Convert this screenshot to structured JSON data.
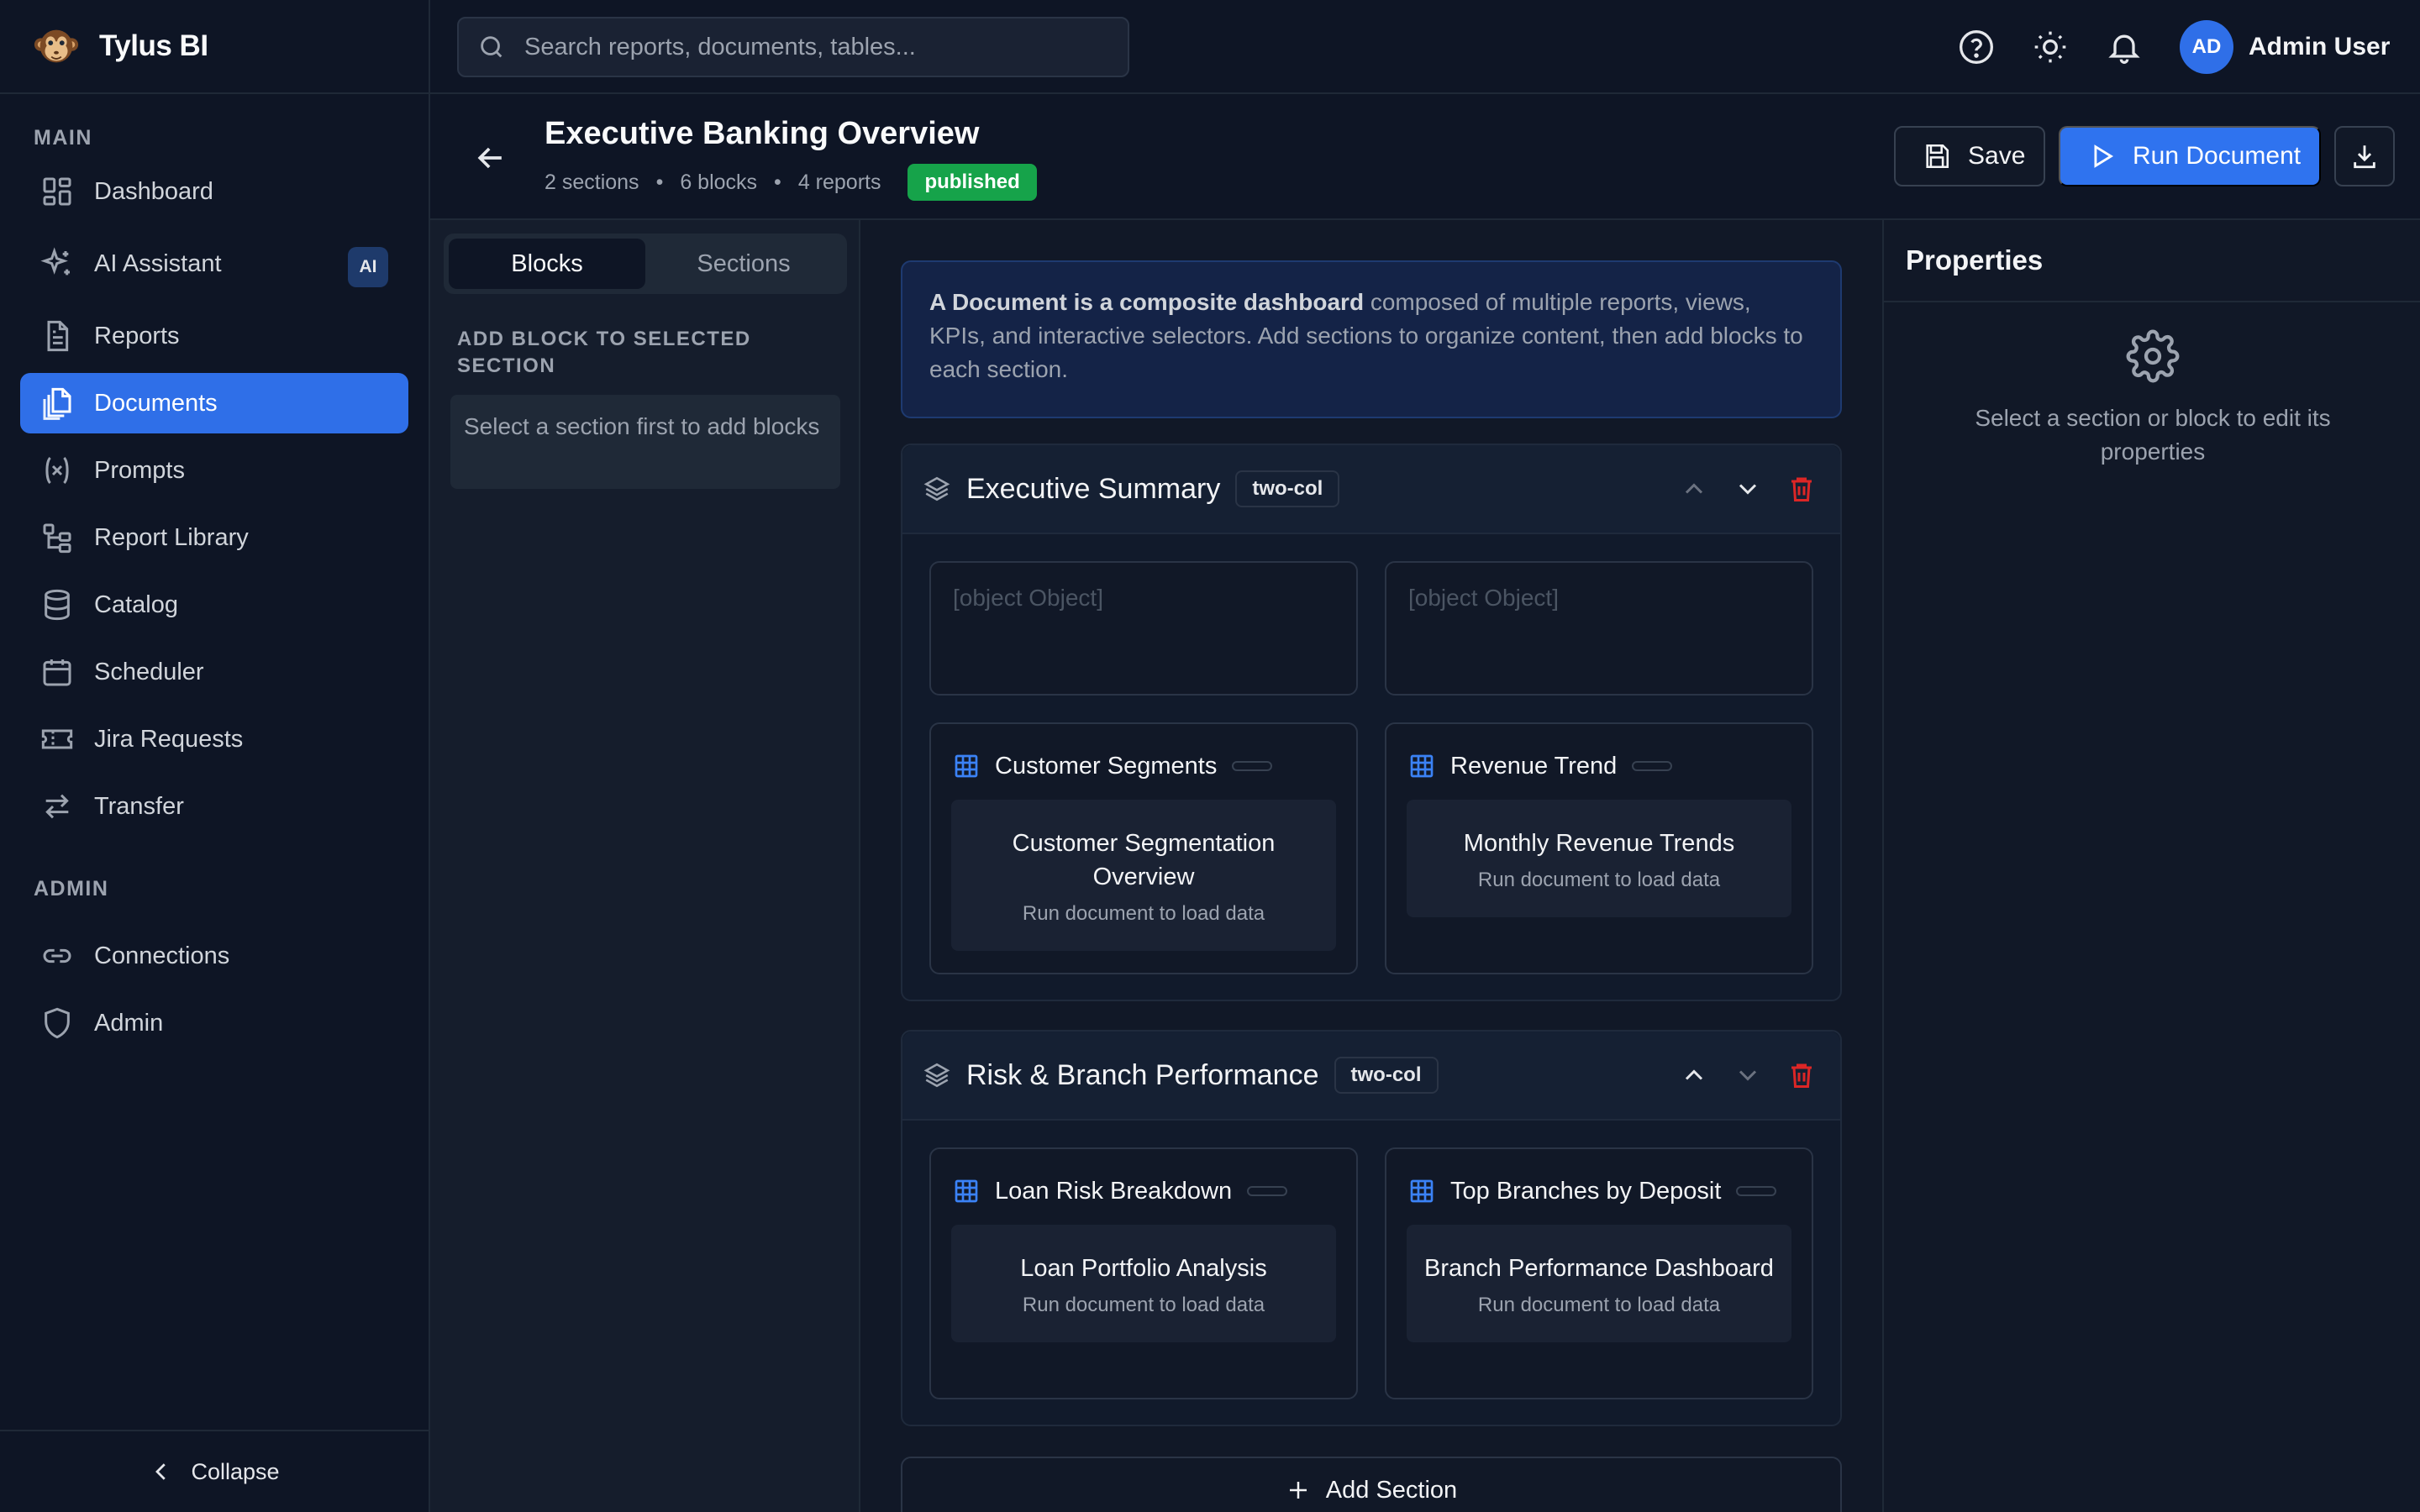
{
  "app": {
    "name": "Tylus BI"
  },
  "sidebar": {
    "main_title": "MAIN",
    "admin_title": "ADMIN",
    "main_items": [
      {
        "label": "Dashboard",
        "icon": "dashboard-icon"
      },
      {
        "label": "AI Assistant",
        "icon": "sparkles-icon",
        "badge": "AI"
      },
      {
        "label": "Reports",
        "icon": "report-icon"
      },
      {
        "label": "Documents",
        "icon": "documents-icon",
        "active": true
      },
      {
        "label": "Prompts",
        "icon": "variable-icon"
      },
      {
        "label": "Report Library",
        "icon": "tree-icon"
      },
      {
        "label": "Catalog",
        "icon": "database-icon"
      },
      {
        "label": "Scheduler",
        "icon": "calendar-icon"
      },
      {
        "label": "Jira Requests",
        "icon": "ticket-icon"
      },
      {
        "label": "Transfer",
        "icon": "transfer-icon"
      }
    ],
    "admin_items": [
      {
        "label": "Connections",
        "icon": "link-icon"
      },
      {
        "label": "Admin",
        "icon": "shield-icon"
      }
    ],
    "collapse_label": "Collapse"
  },
  "topbar": {
    "search_placeholder": "Search reports, documents, tables...",
    "user": {
      "initials": "AD",
      "name": "Admin User"
    }
  },
  "document": {
    "title": "Executive Banking Overview",
    "meta": {
      "sections": "2 sections",
      "blocks": "6 blocks",
      "reports": "4 reports",
      "separator": "•"
    },
    "status": "published",
    "actions": {
      "save": "Save",
      "run": "Run Document"
    }
  },
  "palette": {
    "tabs": [
      "Blocks",
      "Sections"
    ],
    "active_tab": "Blocks",
    "title": "ADD BLOCK TO SELECTED SECTION",
    "hint": "Select a section first to add blocks"
  },
  "canvas": {
    "info_bold": "A Document is a composite dashboard",
    "info_rest": " composed of multiple reports, views, KPIs, and interactive selectors. Add sections to organize content, then add blocks to each section.",
    "sections": [
      {
        "title": "Executive Summary",
        "layout": "two-col",
        "placeholders": [
          "[object Object]",
          "[object Object]"
        ],
        "blocks": [
          {
            "title": "Customer Segments",
            "report": "Customer Segmentation Overview",
            "hint": "Run document to load data"
          },
          {
            "title": "Revenue Trend",
            "report": "Monthly Revenue Trends",
            "hint": "Run document to load data"
          }
        ]
      },
      {
        "title": "Risk & Branch Performance",
        "layout": "two-col",
        "blocks": [
          {
            "title": "Loan Risk Breakdown",
            "report": "Loan Portfolio Analysis",
            "hint": "Run document to load data"
          },
          {
            "title": "Top Branches by Deposit",
            "report": "Branch Performance Dashboard",
            "hint": "Run document to load data"
          }
        ]
      }
    ],
    "add_section": "Add Section"
  },
  "properties": {
    "title": "Properties",
    "empty": "Select a section or block to edit its properties"
  },
  "colors": {
    "accent": "#2f73ef",
    "published": "#16a34a",
    "delete": "#dc2626",
    "block_icon": "#3b82f6"
  }
}
